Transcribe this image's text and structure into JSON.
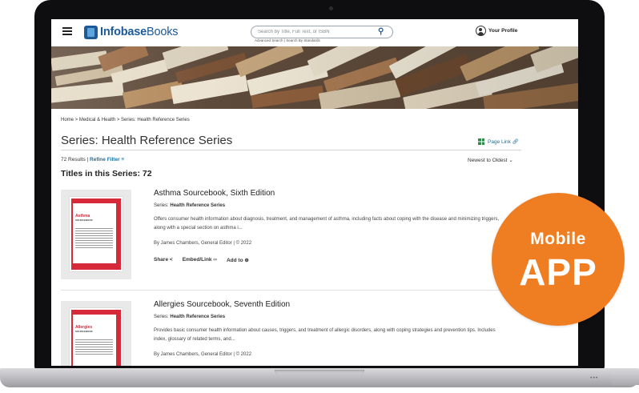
{
  "header": {
    "logo_prefix": "Infobase",
    "logo_suffix": "Books",
    "search_placeholder": "Search by Title, Full Text, or ISBN",
    "advanced_search": "Advanced Search",
    "search_by_standards": "Search By Standards",
    "profile_label": "Your Profile"
  },
  "breadcrumb": "Home > Medical & Health > Series: Health Reference Series",
  "page": {
    "title": "Series: Health Reference Series",
    "page_link": "Page Link",
    "results": "72 Results",
    "refine_filter": "Refine Filter",
    "sort": "Newest to Oldest",
    "titles_heading": "Titles in this Series: 72"
  },
  "books": [
    {
      "title": "Asthma Sourcebook, Sixth Edition",
      "series_prefix": "Series:",
      "series_name": "Health Reference Series",
      "description": "Offers consumer health information about diagnosis, treatment, and management of asthma, including facts about coping with the disease and minimizing triggers, along with a special section on asthma i...",
      "byline": "By James Chambers, General Editor | © 2022",
      "cover_title": "Asthma",
      "cover_sub": "SOURCEBOOK",
      "share": "Share",
      "embed": "Embed/Link",
      "add_to": "Add to"
    },
    {
      "title": "Allergies Sourcebook, Seventh Edition",
      "series_prefix": "Series:",
      "series_name": "Health Reference Series",
      "description": "Provides basic consumer health information about causes, triggers, and treatment of allergic disorders, along with coping strategies and prevention tips. Includes index, glossary of related terms, and...",
      "byline": "By James Chambers, General Editor | © 2022",
      "cover_title": "Allergies",
      "cover_sub": "SOURCEBOOK"
    }
  ],
  "badge": {
    "small": "Mobile",
    "big": "APP",
    "color": "#ef7d22"
  },
  "colors": {
    "brand_blue": "#1d5a97",
    "link_blue": "#1d6f9c",
    "cover_red": "#d62a3a"
  }
}
